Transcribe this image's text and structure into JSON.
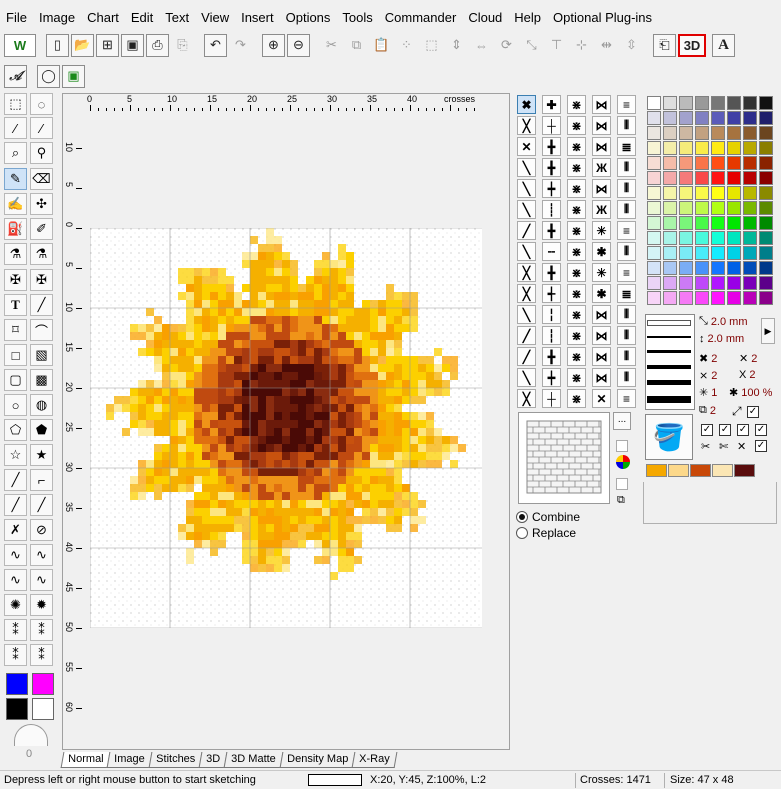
{
  "menu": [
    "File",
    "Image",
    "Chart",
    "Edit",
    "Text",
    "View",
    "Insert",
    "Options",
    "Tools",
    "Commander",
    "Cloud",
    "Help",
    "Optional Plug-ins"
  ],
  "toolbar": {
    "three_d_label": "3D",
    "text_a_label": "A",
    "logo_label": "W"
  },
  "ruler": {
    "h_labels": [
      "0",
      "5",
      "10",
      "15",
      "20",
      "25",
      "30",
      "35",
      "40"
    ],
    "h_unit": "crosses",
    "v_labels": [
      "10",
      "5",
      "0",
      "5",
      "10",
      "15",
      "20",
      "25",
      "30",
      "35",
      "40",
      "45",
      "50",
      "55",
      "60"
    ]
  },
  "tool_counter": "0",
  "tabs": [
    "Normal",
    "Image",
    "Stitches",
    "3D",
    "3D Matte",
    "Density Map",
    "X-Ray"
  ],
  "active_tab": "Normal",
  "fill_mode": {
    "combine_label": "Combine",
    "replace_label": "Replace",
    "selected": "Combine"
  },
  "more_button": "...",
  "line_props": {
    "width1": "2.0 mm",
    "width2": "2.0 mm",
    "a1": "2",
    "a2": "2",
    "b1": "2",
    "b2": "2",
    "c1": "1",
    "zoom": "100 %",
    "d1": "2"
  },
  "status": {
    "hint": "Depress left or right mouse button to start sketching",
    "coords": "X:20, Y:45, Z:100%, L:2",
    "crosses": "Crosses: 1471",
    "size": "Size: 47 x 48"
  },
  "colors": {
    "primary": "#0000ff",
    "secondary": "#ff00ff",
    "black": "#000000",
    "white": "#ffffff",
    "recent": [
      "#f5a800",
      "#fcd88a",
      "#c84808",
      "#fbe6b4",
      "#5a0d0d"
    ]
  }
}
